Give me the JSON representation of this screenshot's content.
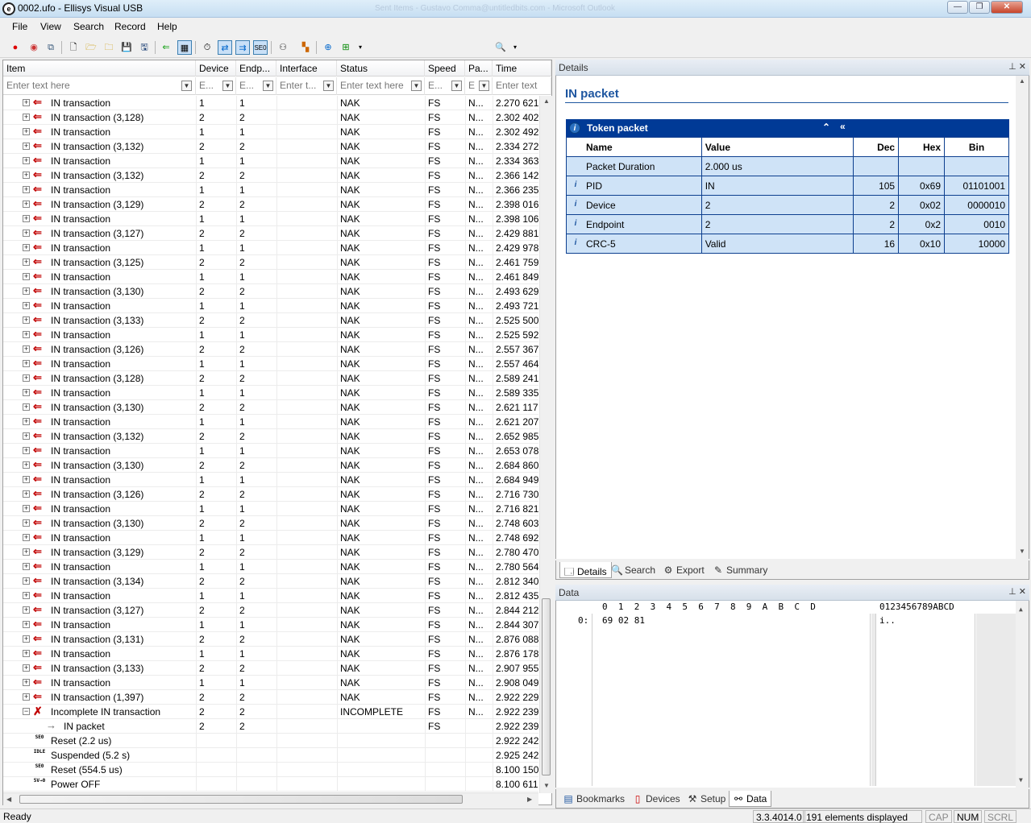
{
  "window": {
    "title": "0002.ufo - Ellisys Visual USB",
    "ghost": "Sent Items - Gustavo Comma@untitledbits.com - Microsoft Outlook",
    "minimize": "—",
    "maximize": "❐",
    "close": "✕"
  },
  "menu": [
    "File",
    "View",
    "Search",
    "Record",
    "Help"
  ],
  "toolbar": {
    "search_placeholder": "Instant Search"
  },
  "columns": [
    "Item",
    "Device",
    "Endp...",
    "Interface",
    "Status",
    "Speed",
    "Pa...",
    "Time"
  ],
  "filters": [
    "Enter text here",
    "E...",
    "E...",
    "Enter t...",
    "Enter text here",
    "E...",
    "E",
    "Enter text"
  ],
  "rows": [
    {
      "item": "IN transaction",
      "dev": "1",
      "ep": "1",
      "status": "NAK",
      "speed": "FS",
      "pa": "N...",
      "time": "2.270 621",
      "kind": "in"
    },
    {
      "item": "IN transaction (3,128)",
      "dev": "2",
      "ep": "2",
      "status": "NAK",
      "speed": "FS",
      "pa": "N...",
      "time": "2.302 402",
      "kind": "in"
    },
    {
      "item": "IN transaction",
      "dev": "1",
      "ep": "1",
      "status": "NAK",
      "speed": "FS",
      "pa": "N...",
      "time": "2.302 492",
      "kind": "in"
    },
    {
      "item": "IN transaction (3,132)",
      "dev": "2",
      "ep": "2",
      "status": "NAK",
      "speed": "FS",
      "pa": "N...",
      "time": "2.334 272",
      "kind": "in"
    },
    {
      "item": "IN transaction",
      "dev": "1",
      "ep": "1",
      "status": "NAK",
      "speed": "FS",
      "pa": "N...",
      "time": "2.334 363",
      "kind": "in"
    },
    {
      "item": "IN transaction (3,132)",
      "dev": "2",
      "ep": "2",
      "status": "NAK",
      "speed": "FS",
      "pa": "N...",
      "time": "2.366 142",
      "kind": "in"
    },
    {
      "item": "IN transaction",
      "dev": "1",
      "ep": "1",
      "status": "NAK",
      "speed": "FS",
      "pa": "N...",
      "time": "2.366 235",
      "kind": "in"
    },
    {
      "item": "IN transaction (3,129)",
      "dev": "2",
      "ep": "2",
      "status": "NAK",
      "speed": "FS",
      "pa": "N...",
      "time": "2.398 016",
      "kind": "in"
    },
    {
      "item": "IN transaction",
      "dev": "1",
      "ep": "1",
      "status": "NAK",
      "speed": "FS",
      "pa": "N...",
      "time": "2.398 106",
      "kind": "in"
    },
    {
      "item": "IN transaction (3,127)",
      "dev": "2",
      "ep": "2",
      "status": "NAK",
      "speed": "FS",
      "pa": "N...",
      "time": "2.429 881",
      "kind": "in"
    },
    {
      "item": "IN transaction",
      "dev": "1",
      "ep": "1",
      "status": "NAK",
      "speed": "FS",
      "pa": "N...",
      "time": "2.429 978",
      "kind": "in"
    },
    {
      "item": "IN transaction (3,125)",
      "dev": "2",
      "ep": "2",
      "status": "NAK",
      "speed": "FS",
      "pa": "N...",
      "time": "2.461 759",
      "kind": "in"
    },
    {
      "item": "IN transaction",
      "dev": "1",
      "ep": "1",
      "status": "NAK",
      "speed": "FS",
      "pa": "N...",
      "time": "2.461 849",
      "kind": "in"
    },
    {
      "item": "IN transaction (3,130)",
      "dev": "2",
      "ep": "2",
      "status": "NAK",
      "speed": "FS",
      "pa": "N...",
      "time": "2.493 629",
      "kind": "in"
    },
    {
      "item": "IN transaction",
      "dev": "1",
      "ep": "1",
      "status": "NAK",
      "speed": "FS",
      "pa": "N...",
      "time": "2.493 721",
      "kind": "in"
    },
    {
      "item": "IN transaction (3,133)",
      "dev": "2",
      "ep": "2",
      "status": "NAK",
      "speed": "FS",
      "pa": "N...",
      "time": "2.525 500",
      "kind": "in"
    },
    {
      "item": "IN transaction",
      "dev": "1",
      "ep": "1",
      "status": "NAK",
      "speed": "FS",
      "pa": "N...",
      "time": "2.525 592",
      "kind": "in"
    },
    {
      "item": "IN transaction (3,126)",
      "dev": "2",
      "ep": "2",
      "status": "NAK",
      "speed": "FS",
      "pa": "N...",
      "time": "2.557 367",
      "kind": "in"
    },
    {
      "item": "IN transaction",
      "dev": "1",
      "ep": "1",
      "status": "NAK",
      "speed": "FS",
      "pa": "N...",
      "time": "2.557 464",
      "kind": "in"
    },
    {
      "item": "IN transaction (3,128)",
      "dev": "2",
      "ep": "2",
      "status": "NAK",
      "speed": "FS",
      "pa": "N...",
      "time": "2.589 241",
      "kind": "in"
    },
    {
      "item": "IN transaction",
      "dev": "1",
      "ep": "1",
      "status": "NAK",
      "speed": "FS",
      "pa": "N...",
      "time": "2.589 335",
      "kind": "in"
    },
    {
      "item": "IN transaction (3,130)",
      "dev": "2",
      "ep": "2",
      "status": "NAK",
      "speed": "FS",
      "pa": "N...",
      "time": "2.621 117",
      "kind": "in"
    },
    {
      "item": "IN transaction",
      "dev": "1",
      "ep": "1",
      "status": "NAK",
      "speed": "FS",
      "pa": "N...",
      "time": "2.621 207",
      "kind": "in"
    },
    {
      "item": "IN transaction (3,132)",
      "dev": "2",
      "ep": "2",
      "status": "NAK",
      "speed": "FS",
      "pa": "N...",
      "time": "2.652 985",
      "kind": "in"
    },
    {
      "item": "IN transaction",
      "dev": "1",
      "ep": "1",
      "status": "NAK",
      "speed": "FS",
      "pa": "N...",
      "time": "2.653 078",
      "kind": "in"
    },
    {
      "item": "IN transaction (3,130)",
      "dev": "2",
      "ep": "2",
      "status": "NAK",
      "speed": "FS",
      "pa": "N...",
      "time": "2.684 860",
      "kind": "in"
    },
    {
      "item": "IN transaction",
      "dev": "1",
      "ep": "1",
      "status": "NAK",
      "speed": "FS",
      "pa": "N...",
      "time": "2.684 949",
      "kind": "in"
    },
    {
      "item": "IN transaction (3,126)",
      "dev": "2",
      "ep": "2",
      "status": "NAK",
      "speed": "FS",
      "pa": "N...",
      "time": "2.716 730",
      "kind": "in"
    },
    {
      "item": "IN transaction",
      "dev": "1",
      "ep": "1",
      "status": "NAK",
      "speed": "FS",
      "pa": "N...",
      "time": "2.716 821",
      "kind": "in"
    },
    {
      "item": "IN transaction (3,130)",
      "dev": "2",
      "ep": "2",
      "status": "NAK",
      "speed": "FS",
      "pa": "N...",
      "time": "2.748 603",
      "kind": "in"
    },
    {
      "item": "IN transaction",
      "dev": "1",
      "ep": "1",
      "status": "NAK",
      "speed": "FS",
      "pa": "N...",
      "time": "2.748 692",
      "kind": "in"
    },
    {
      "item": "IN transaction (3,129)",
      "dev": "2",
      "ep": "2",
      "status": "NAK",
      "speed": "FS",
      "pa": "N...",
      "time": "2.780 470",
      "kind": "in"
    },
    {
      "item": "IN transaction",
      "dev": "1",
      "ep": "1",
      "status": "NAK",
      "speed": "FS",
      "pa": "N...",
      "time": "2.780 564",
      "kind": "in"
    },
    {
      "item": "IN transaction (3,134)",
      "dev": "2",
      "ep": "2",
      "status": "NAK",
      "speed": "FS",
      "pa": "N...",
      "time": "2.812 340",
      "kind": "in"
    },
    {
      "item": "IN transaction",
      "dev": "1",
      "ep": "1",
      "status": "NAK",
      "speed": "FS",
      "pa": "N...",
      "time": "2.812 435",
      "kind": "in"
    },
    {
      "item": "IN transaction (3,127)",
      "dev": "2",
      "ep": "2",
      "status": "NAK",
      "speed": "FS",
      "pa": "N...",
      "time": "2.844 212",
      "kind": "in"
    },
    {
      "item": "IN transaction",
      "dev": "1",
      "ep": "1",
      "status": "NAK",
      "speed": "FS",
      "pa": "N...",
      "time": "2.844 307",
      "kind": "in"
    },
    {
      "item": "IN transaction (3,131)",
      "dev": "2",
      "ep": "2",
      "status": "NAK",
      "speed": "FS",
      "pa": "N...",
      "time": "2.876 088",
      "kind": "in"
    },
    {
      "item": "IN transaction",
      "dev": "1",
      "ep": "1",
      "status": "NAK",
      "speed": "FS",
      "pa": "N...",
      "time": "2.876 178",
      "kind": "in"
    },
    {
      "item": "IN transaction (3,133)",
      "dev": "2",
      "ep": "2",
      "status": "NAK",
      "speed": "FS",
      "pa": "N...",
      "time": "2.907 955",
      "kind": "in"
    },
    {
      "item": "IN transaction",
      "dev": "1",
      "ep": "1",
      "status": "NAK",
      "speed": "FS",
      "pa": "N...",
      "time": "2.908 049",
      "kind": "in"
    },
    {
      "item": "IN transaction (1,397)",
      "dev": "2",
      "ep": "2",
      "status": "NAK",
      "speed": "FS",
      "pa": "N...",
      "time": "2.922 229",
      "kind": "in"
    },
    {
      "item": "Incomplete IN transaction",
      "dev": "2",
      "ep": "2",
      "status": "INCOMPLETE",
      "speed": "FS",
      "pa": "N...",
      "time": "2.922 239",
      "kind": "incomplete"
    },
    {
      "item": "IN packet",
      "dev": "2",
      "ep": "2",
      "status": "",
      "speed": "FS",
      "pa": "",
      "time": "2.922 239",
      "kind": "packet"
    },
    {
      "item": "Reset (2.2 us)",
      "dev": "",
      "ep": "",
      "status": "",
      "speed": "",
      "pa": "",
      "time": "2.922 242",
      "kind": "seo"
    },
    {
      "item": "Suspended (5.2 s)",
      "dev": "",
      "ep": "",
      "status": "",
      "speed": "",
      "pa": "",
      "time": "2.925 242",
      "kind": "idle"
    },
    {
      "item": "Reset (554.5 us)",
      "dev": "",
      "ep": "",
      "status": "",
      "speed": "",
      "pa": "",
      "time": "8.100 150",
      "kind": "seo"
    },
    {
      "item": "Power OFF",
      "dev": "",
      "ep": "",
      "status": "",
      "speed": "",
      "pa": "",
      "time": "8.100 611",
      "kind": "power"
    }
  ],
  "badges": {
    "seo": "SE0",
    "idle": "IDLE",
    "power": "5V→0"
  },
  "details": {
    "pane_title": "Details",
    "heading": "IN packet",
    "section": "Token packet",
    "col_name": "Name",
    "col_value": "Value",
    "col_dec": "Dec",
    "col_hex": "Hex",
    "col_bin": "Bin",
    "fields": [
      {
        "name": "Packet Duration",
        "value": "2.000 us",
        "dec": "",
        "hex": "",
        "bin": "",
        "icon": false
      },
      {
        "name": "PID",
        "value": "IN",
        "dec": "105",
        "hex": "0x69",
        "bin": "01101001",
        "icon": true
      },
      {
        "name": "Device",
        "value": "2",
        "dec": "2",
        "hex": "0x02",
        "bin": "0000010",
        "icon": true
      },
      {
        "name": "Endpoint",
        "value": "2",
        "dec": "2",
        "hex": "0x2",
        "bin": "0010",
        "icon": true
      },
      {
        "name": "CRC-5",
        "value": "Valid",
        "dec": "16",
        "hex": "0x10",
        "bin": "10000",
        "icon": true
      }
    ],
    "tabs": [
      "Details",
      "Search",
      "Export",
      "Summary"
    ]
  },
  "data_pane": {
    "title": "Data",
    "header": "0  1  2  3  4  5  6  7  8  9  A  B  C  D",
    "ascii_header": "0123456789ABCD",
    "offset": "0:",
    "hex": "69 02 81",
    "ascii": "i..",
    "tabs": [
      "Bookmarks",
      "Devices",
      "Setup",
      "Data"
    ]
  },
  "status": {
    "ready": "Ready",
    "version": "3.3.4014.0",
    "count": "191 elements displayed",
    "cap": "CAP",
    "num": "NUM",
    "scrl": "SCRL"
  }
}
